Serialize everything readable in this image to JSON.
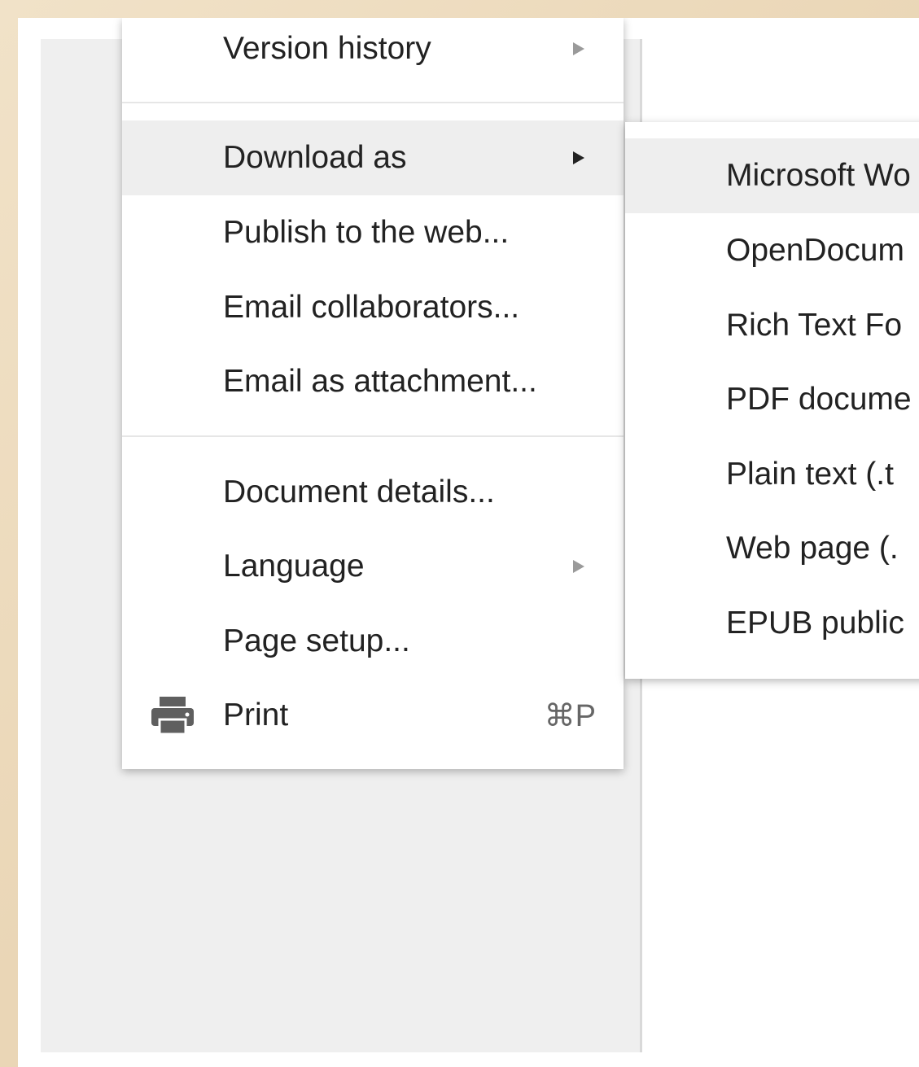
{
  "file_menu": {
    "items": [
      {
        "label": "Version history",
        "has_submenu": true,
        "active": false
      },
      {
        "label": "Download as",
        "has_submenu": true,
        "active": true
      },
      {
        "label": "Publish to the web...",
        "has_submenu": false,
        "active": false
      },
      {
        "label": "Email collaborators...",
        "has_submenu": false,
        "active": false
      },
      {
        "label": "Email as attachment...",
        "has_submenu": false,
        "active": false
      },
      {
        "label": "Document details...",
        "has_submenu": false,
        "active": false
      },
      {
        "label": "Language",
        "has_submenu": true,
        "active": false
      },
      {
        "label": "Page setup...",
        "has_submenu": false,
        "active": false
      },
      {
        "label": "Print",
        "shortcut": "⌘P",
        "icon": "printer-icon",
        "active": false
      }
    ]
  },
  "download_submenu": {
    "items": [
      {
        "label": "Microsoft Wo",
        "active": true
      },
      {
        "label": "OpenDocum",
        "active": false
      },
      {
        "label": "Rich Text Fo",
        "active": false
      },
      {
        "label": "PDF docume",
        "active": false
      },
      {
        "label": "Plain text (.t",
        "active": false
      },
      {
        "label": "Web page (.",
        "active": false
      },
      {
        "label": "EPUB public",
        "active": false
      }
    ]
  },
  "colors": {
    "menu_bg": "#ffffff",
    "hover_bg": "#eeeeee",
    "text": "#222222",
    "arrow_inactive": "#9a9a9a",
    "document_bg": "#efefef"
  }
}
